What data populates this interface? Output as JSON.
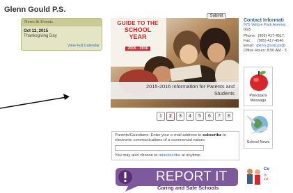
{
  "school": {
    "name": "Glenn Gould P.S."
  },
  "news": {
    "heading": "News & Events",
    "date": "Oct 12, 2015",
    "event": "Thanksgiving Day",
    "link": "View Full Calendar"
  },
  "hero": {
    "badge_line1": "GUIDE TO THE",
    "badge_line2": "SCHOOL YEAR",
    "badge_line3": "2015 - 2016",
    "caption_line1": "2015-2016 Information for Parents and",
    "caption_line2": "Students"
  },
  "pager": {
    "pages": [
      "1",
      "2",
      "3",
      "4",
      "5",
      "6",
      "7",
      "8"
    ],
    "active": "2"
  },
  "subscribe": {
    "text_pre": "Parents/Guardians: Enter your e-mail address to ",
    "text_bold": "subscribe",
    "text_post": " to electronic communications of a commercial nature.",
    "button": "Submit",
    "unsub_pre": "You may also choose to ",
    "unsub_link": "unsubscribe",
    "unsub_post": " at anytime."
  },
  "report": {
    "title": "REPORT IT",
    "subtitle": "Caring and Safe Schools"
  },
  "contact": {
    "title": "Contact Informati",
    "address": "675 Vellore Park Avenue,",
    "postal": "0G5",
    "phone_label": "Phone:",
    "phone": "(905) 417-4517,",
    "fax_label": "Fax:",
    "fax": "(905) 417-4540",
    "email_label": "Email:",
    "email": "glenn.gould.ps@",
    "hours": "Office Hours: 8:50 AM - 3"
  },
  "tiles": {
    "principal_line1": "Principal's",
    "principal_line2": "Message",
    "school_news": "School News"
  },
  "partial": {
    "title": "Co",
    "line1": "Gr",
    "line2": "Ind"
  },
  "colors": {
    "accent_red": "#d8262b",
    "report_purple": "#6a3b8a",
    "news_bg": "#e4e5c4",
    "link_blue": "#3a6aa7"
  }
}
